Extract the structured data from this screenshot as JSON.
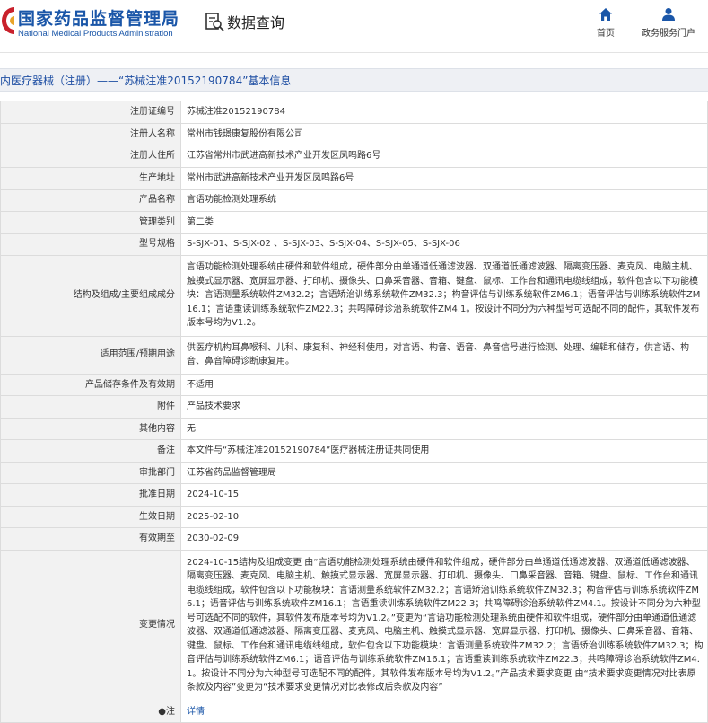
{
  "header": {
    "logo_cn": "国家药品监督管理局",
    "logo_en": "National Medical Products Administration",
    "data_query": "数据查询",
    "nav_home": "首页",
    "nav_portal": "政务服务门户",
    "brand_color": "#1a56a8"
  },
  "page_title": "内医疗器械（注册）——“苏械注准20152190784”基本信息",
  "rows": [
    {
      "label": "注册证编号",
      "value": "苏械注准20152190784"
    },
    {
      "label": "注册人名称",
      "value": "常州市钱璟康复股份有限公司"
    },
    {
      "label": "注册人住所",
      "value": "江苏省常州市武进高新技术产业开发区凤鸣路6号"
    },
    {
      "label": "生产地址",
      "value": "常州市武进高新技术产业开发区凤鸣路6号"
    },
    {
      "label": "产品名称",
      "value": "言语功能检测处理系统"
    },
    {
      "label": "管理类别",
      "value": "第二类"
    },
    {
      "label": "型号规格",
      "value": "S-SJX-01、S-SJX-02 、S-SJX-03、S-SJX-04、S-SJX-05、S-SJX-06"
    },
    {
      "label": "结构及组成/主要组成成分",
      "value": "言语功能检测处理系统由硬件和软件组成，硬件部分由单通道低通滤波器、双通道低通滤波器、隔离变压器、麦克风、电脑主机、触摸式显示器、宽屏显示器、打印机、摄像头、口鼻采音器、音箱、键盘、鼠标、工作台和通讯电缆线组成，软件包含以下功能模块：言语测量系统软件ZM32.2；言语矫治训练系统软件ZM32.3；构音评估与训练系统软件ZM6.1；语音评估与训练系统软件ZM16.1；言语重读训练系统软件ZM22.3；共鸣障碍诊治系统软件ZM4.1。按设计不同分为六种型号可选配不同的配件，其软件发布版本号均为V1.2。"
    },
    {
      "label": "适用范围/预期用途",
      "value": "供医疗机构耳鼻喉科、儿科、康复科、神经科使用，对言语、构音、语音、鼻音信号进行检测、处理、编辑和储存，供言语、构音、鼻音障碍诊断康复用。"
    },
    {
      "label": "产品储存条件及有效期",
      "value": "不适用"
    },
    {
      "label": "附件",
      "value": "产品技术要求"
    },
    {
      "label": "其他内容",
      "value": "无"
    },
    {
      "label": "备注",
      "value": "本文件与“苏械注准20152190784”医疗器械注册证共同使用"
    },
    {
      "label": "审批部门",
      "value": "江苏省药品监督管理局"
    },
    {
      "label": "批准日期",
      "value": "2024-10-15"
    },
    {
      "label": "生效日期",
      "value": "2025-02-10"
    },
    {
      "label": "有效期至",
      "value": "2030-02-09"
    },
    {
      "label": "变更情况",
      "value": "2024-10-15结构及组成变更 由“言语功能检测处理系统由硬件和软件组成，硬件部分由单通道低通滤波器、双通道低通滤波器、隔离变压器、麦克风、电脑主机、触摸式显示器、宽屏显示器、打印机、摄像头、口鼻采音器、音箱、键盘、鼠标、工作台和通讯电缆线组成，软件包含以下功能模块：言语测量系统软件ZM32.2；言语矫治训练系统软件ZM32.3；构音评估与训练系统软件ZM6.1；语音评估与训练系统软件ZM16.1；言语重读训练系统软件ZM22.3；共鸣障碍诊治系统软件ZM4.1。按设计不同分为六种型号可选配不同的软件，其软件发布版本号均为V1.2。”变更为“言语功能检测处理系统由硬件和软件组成，硬件部分由单通道低通滤波器、双通道低通滤波器、隔离变压器、麦克风、电脑主机、触摸式显示器、宽屏显示器、打印机、摄像头、口鼻采音器、音箱、键盘、鼠标、工作台和通讯电缆线组成，软件包含以下功能模块：言语测量系统软件ZM32.2；言语矫治训练系统软件ZM32.3；构音评估与训练系统软件ZM6.1；语音评估与训练系统软件ZM16.1；言语重读训练系统软件ZM22.3；共鸣障碍诊治系统软件ZM4.1。按设计不同分为六种型号可选配不同的配件，其软件发布版本号均为V1.2。”产品技术要求变更 由“技术要求变更情况对比表原条款及内容”变更为“技术要求变更情况对比表修改后条款及内容”"
    }
  ],
  "note_row": {
    "label": "●注",
    "link": "详情"
  }
}
